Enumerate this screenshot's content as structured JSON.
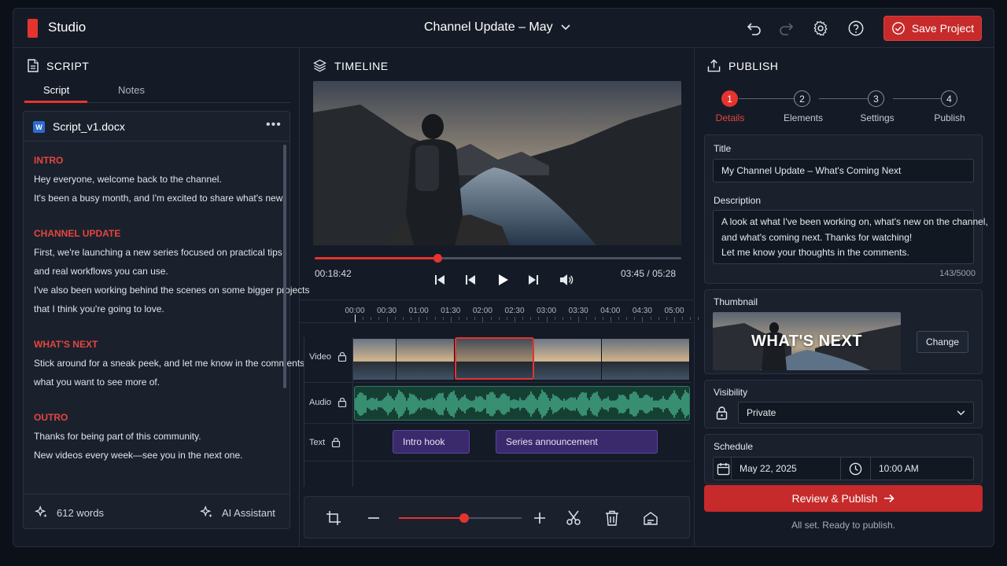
{
  "header": {
    "app_name": "Studio",
    "project_title": "Channel Update – May",
    "save_label": "Save Project"
  },
  "script_panel": {
    "title": "SCRIPT",
    "tabs": [
      {
        "label": "Script"
      },
      {
        "label": "Notes"
      }
    ],
    "active_tab": "Script",
    "document": {
      "file_icon": "W",
      "file_name": "Script_v1.docx",
      "sections": [
        {
          "heading": "INTRO",
          "lines": [
            "Hey everyone, welcome back to the channel.",
            "It's been a busy month, and I'm excited to share what's new."
          ]
        },
        {
          "heading": "CHANNEL UPDATE",
          "lines": [
            "First, we're launching a new series focused on practical tips",
            "and real workflows you can use.",
            "I've also been working behind the scenes on some bigger projects",
            "that I think you're going to love."
          ]
        },
        {
          "heading": "WHAT'S NEXT",
          "lines": [
            "Stick around for a sneak peek, and let me know in the comments",
            "what you want to see more of."
          ]
        },
        {
          "heading": "OUTRO",
          "lines": [
            "Thanks for being part of this community.",
            "New videos every week—see you in the next one."
          ]
        }
      ]
    },
    "word_count": "612 words",
    "ai_label": "AI Assistant"
  },
  "timeline_panel": {
    "title": "TIMELINE",
    "current_time": "00:18:42",
    "position": "03:45",
    "separator": "/",
    "duration": "05:28",
    "playback_progress": 0.335,
    "ruler": [
      "00:00",
      "00:30",
      "01:00",
      "01:30",
      "02:00",
      "02:30",
      "03:00",
      "03:30",
      "04:00",
      "04:30",
      "05:00"
    ],
    "tracks": {
      "video": "Video",
      "audio": "Audio",
      "text": "Text"
    },
    "text_clips": [
      {
        "label": "Intro hook"
      },
      {
        "label": "Series announcement"
      }
    ],
    "zoom_level": 0.53
  },
  "publish_panel": {
    "title": "PUBLISH",
    "steps": [
      {
        "number": "1",
        "label": "Details"
      },
      {
        "number": "2",
        "label": "Elements"
      },
      {
        "number": "3",
        "label": "Settings"
      },
      {
        "number": "4",
        "label": "Publish"
      }
    ],
    "active_step": 1,
    "title_label": "Title",
    "title_value": "My Channel Update – What's Coming Next",
    "description_label": "Description",
    "description_lines": [
      "A look at what I've been working on, what's new on the channel,",
      "and what's coming next. Thanks for watching!",
      "Let me know your thoughts in the comments."
    ],
    "char_count": "143/5000",
    "thumbnail_label": "Thumbnail",
    "thumbnail_text": "WHAT'S NEXT",
    "change_label": "Change",
    "visibility_label": "Visibility",
    "visibility_value": "Private",
    "schedule_label": "Schedule",
    "schedule_date": "May 22, 2025",
    "schedule_time": "10:00 AM",
    "publish_label": "Review & Publish",
    "status_text": "All set. Ready to publish."
  },
  "colors": {
    "accent": "#e5342f",
    "background": "#151b26",
    "audio_wave": "#4fc49a",
    "text_clip": "#3a2a6b"
  },
  "icons": [
    "logo-icon",
    "chevron-down-icon",
    "undo-icon",
    "redo-icon",
    "gear-icon",
    "help-icon",
    "check-circle-icon",
    "document-icon",
    "word-file-icon",
    "more-icon",
    "sparkle-icon",
    "layers-icon",
    "skip-back-icon",
    "step-back-icon",
    "play-icon",
    "step-forward-icon",
    "volume-icon",
    "lock-icon",
    "crop-icon",
    "minus-icon",
    "plus-icon",
    "scissors-icon",
    "trash-icon",
    "magic-icon",
    "upload-icon",
    "calendar-icon",
    "clock-icon",
    "arrow-right-icon"
  ]
}
